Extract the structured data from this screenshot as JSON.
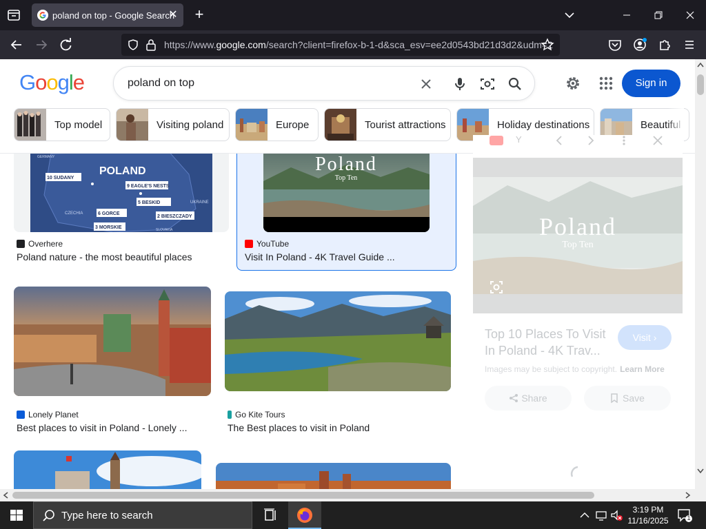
{
  "browser": {
    "tab_title": "poland on top - Google Search",
    "url_prefix": "https://www.",
    "url_domain": "google.com",
    "url_rest": "/search?client=firefox-b-1-d&sca_esv=ee2d0543bd21d3d2&udm=2"
  },
  "google": {
    "logo_letters": [
      "G",
      "o",
      "o",
      "g",
      "l",
      "e"
    ],
    "logo_colors": [
      "#4285f4",
      "#ea4335",
      "#fbbc05",
      "#4285f4",
      "#34a853",
      "#ea4335"
    ],
    "query": "poland on top",
    "sign_in_label": "Sign in"
  },
  "chips": [
    {
      "label": "Top model"
    },
    {
      "label": "Visiting poland"
    },
    {
      "label": "Europe"
    },
    {
      "label": "Tourist attractions"
    },
    {
      "label": "Holiday destinations"
    },
    {
      "label": "Beautiful"
    }
  ],
  "results": [
    {
      "source": "Overhere",
      "title": "Poland nature - the most beautiful places",
      "map_title": "POLAND",
      "map_labels": [
        "10 SUDANY",
        "9 EAGLE'S NESTS",
        "5 BESKID",
        "6 GORCE",
        "2 BIESZCZADY",
        "3 MORSKIE",
        "CZECHIA",
        "UKRAINE",
        "GERMANY",
        "SLOVAKIA"
      ]
    },
    {
      "source": "YouTube",
      "title": "Visit In Poland - 4K Travel Guide ...",
      "overlay_title": "Poland",
      "overlay_sub": "Top Ten"
    },
    {
      "source": "Lonely Planet",
      "title": "Best places to visit in Poland - Lonely ..."
    },
    {
      "source": "Go Kite Tours",
      "title": "The Best places to visit in Poland"
    }
  ],
  "preview": {
    "source_short": "Y",
    "image_title": "Poland",
    "image_sub": "Top Ten",
    "title": "Top 10 Places To Visit In Poland - 4K Trav...",
    "visit_label": "Visit",
    "copyright_text": "Images may be subject to copyright.",
    "learn_more": "Learn More",
    "share_label": "Share",
    "save_label": "Save"
  },
  "taskbar": {
    "search_placeholder": "Type here to search",
    "time": "3:19 PM",
    "date": "11/16/2025",
    "notification_count": "1"
  }
}
